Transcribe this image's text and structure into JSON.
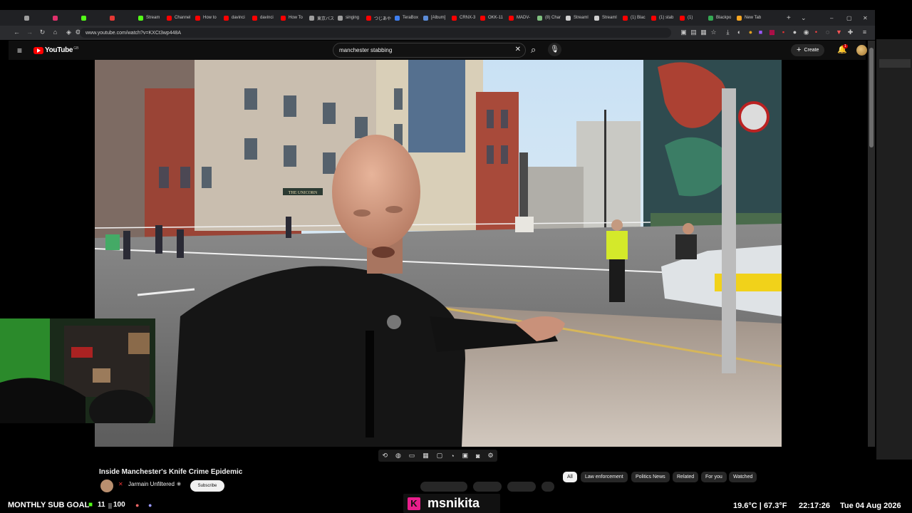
{
  "browser": {
    "tabs": [
      {
        "label": "",
        "color": "#9e9e9e"
      },
      {
        "label": "",
        "color": "#e1306c"
      },
      {
        "label": "",
        "color": "#53fc18"
      },
      {
        "label": "",
        "color": "#e53935"
      },
      {
        "label": "Stream",
        "color": "#53fc18"
      },
      {
        "label": "Channel",
        "color": "#ff0000"
      },
      {
        "label": "How to",
        "color": "#ff0000"
      },
      {
        "label": "davinci",
        "color": "#ff0000"
      },
      {
        "label": "davinci",
        "color": "#ff0000"
      },
      {
        "label": "How To",
        "color": "#ff0000"
      },
      {
        "label": "東京バス",
        "color": "#9e9e9e"
      },
      {
        "label": "singing",
        "color": "#9e9e9e"
      },
      {
        "label": "つじあや",
        "color": "#ff0000"
      },
      {
        "label": "TeraBox",
        "color": "#3f7ff0"
      },
      {
        "label": "[Album]",
        "color": "#5b8bd6"
      },
      {
        "label": "CRNX-3",
        "color": "#ff0000"
      },
      {
        "label": "OKK-11",
        "color": "#ff0000"
      },
      {
        "label": "MADV-",
        "color": "#ff0000"
      },
      {
        "label": "(8) Char",
        "color": "#7fbf7f"
      },
      {
        "label": "Streaml",
        "color": "#cfcfcf"
      },
      {
        "label": "Streaml",
        "color": "#cfcfcf"
      },
      {
        "label": "(1) Blac",
        "color": "#ff0000"
      },
      {
        "label": "(1) stab",
        "color": "#ff0000"
      },
      {
        "label": "(1)",
        "color": "#ff0000"
      },
      {
        "label": "Blackpo",
        "color": "#34a853"
      },
      {
        "label": "New Tab",
        "color": "#f6a623"
      }
    ],
    "new_tab": "+",
    "tab_search": "⌄",
    "minimize": "–",
    "maximize": "▢",
    "close": "✕",
    "url": "www.youtube.com/watch?v=KXCt3wp448A"
  },
  "youtube": {
    "logo": "YouTube",
    "country": "GB",
    "search_query": "manchester stabbing",
    "create_label": "Create",
    "notifications_count": "1",
    "video_title": "Inside Manchester's Knife Crime Epidemic",
    "channel_name": "Jarmain Unfiltered",
    "subscribe_label": "Subscribe",
    "chips": [
      "All",
      "Law enforcement",
      "Politics News",
      "Related",
      "For you",
      "Watched"
    ]
  },
  "overlay": {
    "sub_goal_label": "MONTHLY SUB GOAL",
    "sub_count": "11",
    "sub_target": "100",
    "streamer_name": "msnikita",
    "temperature": "19.6°C  |  67.3°F",
    "time": "22:17:26",
    "date": "Tue 04 Aug 2026"
  },
  "video_scene": {
    "pub_sign": "THE UNICORN"
  }
}
